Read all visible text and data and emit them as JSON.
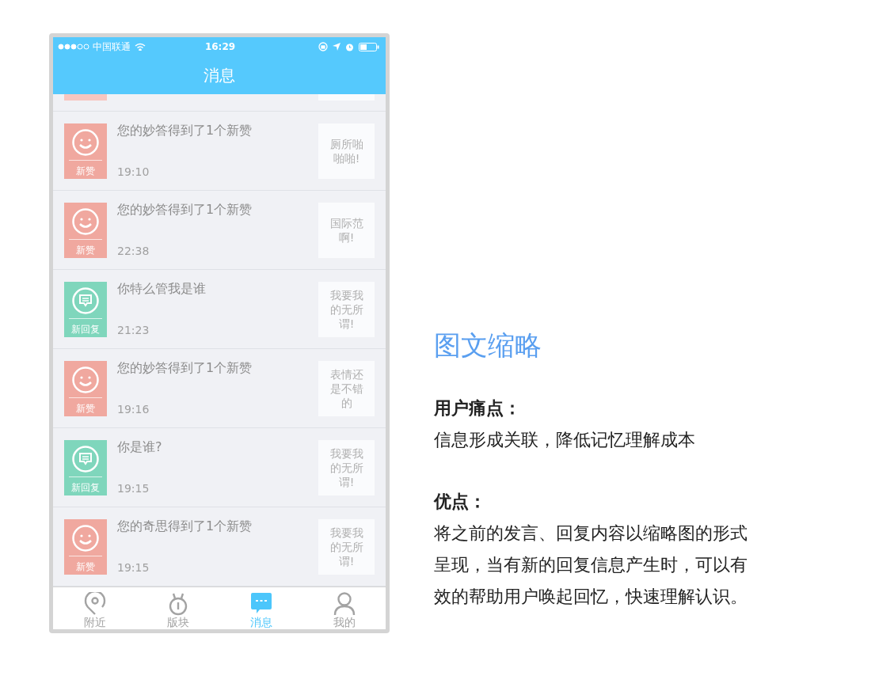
{
  "status_bar": {
    "carrier": "中国联通",
    "time": "16:29"
  },
  "nav_bar": {
    "title": "消息"
  },
  "messages": [
    {
      "kind": "like",
      "badge": "新赞",
      "text": "您的妙答得到了1个新赞",
      "time": "19:10",
      "thumbnail": "厕所啪啪啪!"
    },
    {
      "kind": "like",
      "badge": "新赞",
      "text": "您的妙答得到了1个新赞",
      "time": "22:38",
      "thumbnail": "国际范啊!"
    },
    {
      "kind": "reply",
      "badge": "新回复",
      "text": "你特么管我是谁",
      "time": "21:23",
      "thumbnail": "我要我的无所谓!"
    },
    {
      "kind": "like",
      "badge": "新赞",
      "text": "您的妙答得到了1个新赞",
      "time": "19:16",
      "thumbnail": "表情还是不错的"
    },
    {
      "kind": "reply",
      "badge": "新回复",
      "text": "你是谁?",
      "time": "19:15",
      "thumbnail": "我要我的无所谓!"
    },
    {
      "kind": "like",
      "badge": "新赞",
      "text": "您的奇思得到了1个新赞",
      "time": "19:15",
      "thumbnail": "我要我的无所谓!"
    }
  ],
  "tab_bar": [
    {
      "kind": "nearby",
      "label": "附近",
      "selected": false
    },
    {
      "kind": "boards",
      "label": "版块",
      "selected": false
    },
    {
      "kind": "messages",
      "label": "消息",
      "selected": true
    },
    {
      "kind": "profile",
      "label": "我的",
      "selected": false
    }
  ],
  "description": {
    "title": "图文缩略",
    "sections": [
      {
        "heading": "用户痛点：",
        "body": "信息形成关联，降低记忆理解成本"
      },
      {
        "heading": "优点：",
        "body": "将之前的发言、回复内容以缩略图的形式呈现，当有新的回复信息产生时，可以有效的帮助用户唤起回忆，快速理解认识。"
      }
    ]
  }
}
